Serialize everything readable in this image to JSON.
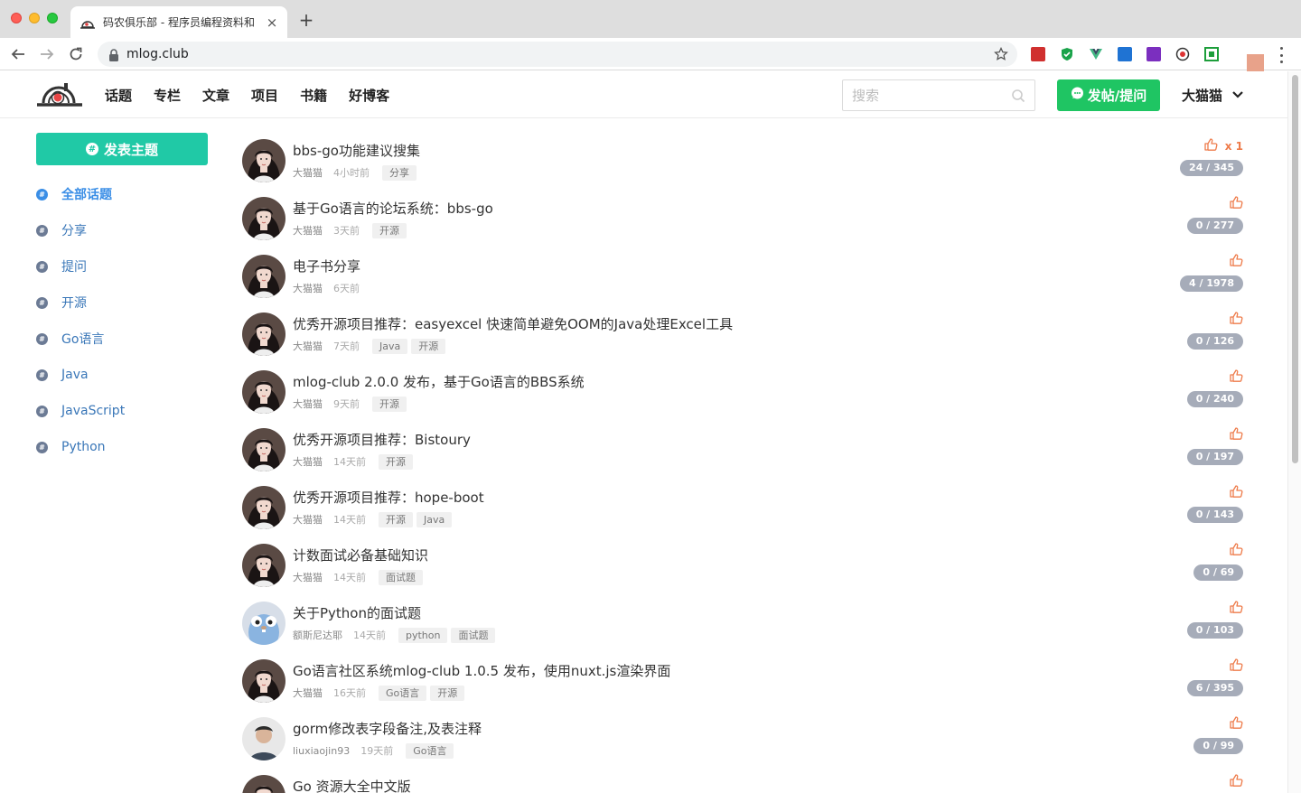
{
  "browser": {
    "tab_title": "码农俱乐部 - 程序员编程资料和",
    "tab_close": "×",
    "new_tab": "+",
    "url": "mlog.club"
  },
  "site": {
    "nav": [
      "话题",
      "专栏",
      "文章",
      "项目",
      "书籍",
      "好博客"
    ],
    "search_placeholder": "搜索",
    "post_button": "发帖/提问",
    "user_name": "大猫猫"
  },
  "sidebar": {
    "new_topic_button": "发表主题",
    "categories": [
      "全部话题",
      "分享",
      "提问",
      "开源",
      "Go语言",
      "Java",
      "JavaScript",
      "Python"
    ]
  },
  "colors": {
    "green_button": "#1fc563",
    "teal_button": "#20c9a6",
    "link_blue": "#3a8ee6",
    "like_orange": "#ee7b4a",
    "counter_gray": "#a6acb9"
  },
  "like_icon": "thumbs-up-icon",
  "topics": [
    {
      "title": "bbs-go功能建议搜集",
      "author": "大猫猫",
      "time": "4小时前",
      "tags": [
        "分享"
      ],
      "likes": "x 1",
      "counter": "24 / 345"
    },
    {
      "title": "基于Go语言的论坛系统：bbs-go",
      "author": "大猫猫",
      "time": "3天前",
      "tags": [
        "开源"
      ],
      "likes": "",
      "counter": "0 / 277"
    },
    {
      "title": "电子书分享",
      "author": "大猫猫",
      "time": "6天前",
      "tags": [],
      "likes": "",
      "counter": "4 / 1978"
    },
    {
      "title": "优秀开源项目推荐：easyexcel 快速简单避免OOM的Java处理Excel工具",
      "author": "大猫猫",
      "time": "7天前",
      "tags": [
        "Java",
        "开源"
      ],
      "likes": "",
      "counter": "0 / 126"
    },
    {
      "title": "mlog-club 2.0.0 发布，基于Go语言的BBS系统",
      "author": "大猫猫",
      "time": "9天前",
      "tags": [
        "开源"
      ],
      "likes": "",
      "counter": "0 / 240"
    },
    {
      "title": "优秀开源项目推荐：Bistoury",
      "author": "大猫猫",
      "time": "14天前",
      "tags": [
        "开源"
      ],
      "likes": "",
      "counter": "0 / 197"
    },
    {
      "title": "优秀开源项目推荐：hope-boot",
      "author": "大猫猫",
      "time": "14天前",
      "tags": [
        "开源",
        "Java"
      ],
      "likes": "",
      "counter": "0 / 143"
    },
    {
      "title": "计数面试必备基础知识",
      "author": "大猫猫",
      "time": "14天前",
      "tags": [
        "面试题"
      ],
      "likes": "",
      "counter": "0 / 69"
    },
    {
      "title": "关于Python的面试题",
      "author": "额斯尼达耶",
      "time": "14天前",
      "tags": [
        "python",
        "面试题"
      ],
      "likes": "",
      "counter": "0 / 103",
      "avatar": "gopher"
    },
    {
      "title": "Go语言社区系统mlog-club 1.0.5 发布，使用nuxt.js渲染界面",
      "author": "大猫猫",
      "time": "16天前",
      "tags": [
        "Go语言",
        "开源"
      ],
      "likes": "",
      "counter": "6 / 395"
    },
    {
      "title": "gorm修改表字段备注,及表注释",
      "author": "liuxiaojin93",
      "time": "19天前",
      "tags": [
        "Go语言"
      ],
      "likes": "",
      "counter": "0 / 99",
      "avatar": "man"
    },
    {
      "title": "Go 资源大全中文版",
      "author": "",
      "time": "",
      "tags": [],
      "likes": "",
      "counter": ""
    }
  ]
}
